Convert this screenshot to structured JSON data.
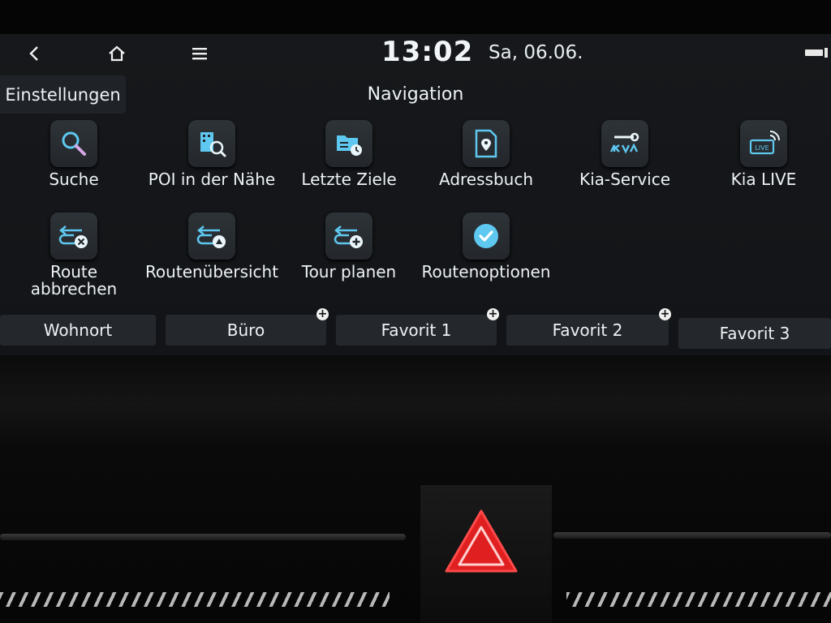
{
  "status": {
    "time": "13:02",
    "date": "Sa, 06.06."
  },
  "header": {
    "settings_label": "Einstellungen",
    "title": "Navigation"
  },
  "menu": [
    {
      "label": "Suche",
      "icon": "search-icon"
    },
    {
      "label": "POI in der Nähe",
      "icon": "poi-nearby-icon"
    },
    {
      "label": "Letzte Ziele",
      "icon": "recent-destinations-icon"
    },
    {
      "label": "Adressbuch",
      "icon": "address-book-icon"
    },
    {
      "label": "Kia-Service",
      "icon": "kia-service-icon"
    },
    {
      "label": "Kia LIVE",
      "icon": "kia-live-icon",
      "badge": "LIVE"
    },
    {
      "label": "Route\nabbrechen",
      "icon": "cancel-route-icon"
    },
    {
      "label": "Routenübersicht",
      "icon": "route-overview-icon"
    },
    {
      "label": "Tour planen",
      "icon": "plan-tour-icon"
    },
    {
      "label": "Routenoptionen",
      "icon": "route-options-icon"
    }
  ],
  "favorites": [
    {
      "label": "Wohnort"
    },
    {
      "label": "Büro"
    },
    {
      "label": "Favorit 1"
    },
    {
      "label": "Favorit 2"
    },
    {
      "label": "Favorit 3"
    }
  ],
  "colors": {
    "accent_blue": "#5ec8f0",
    "hazard_red": "#ff2a2a"
  }
}
